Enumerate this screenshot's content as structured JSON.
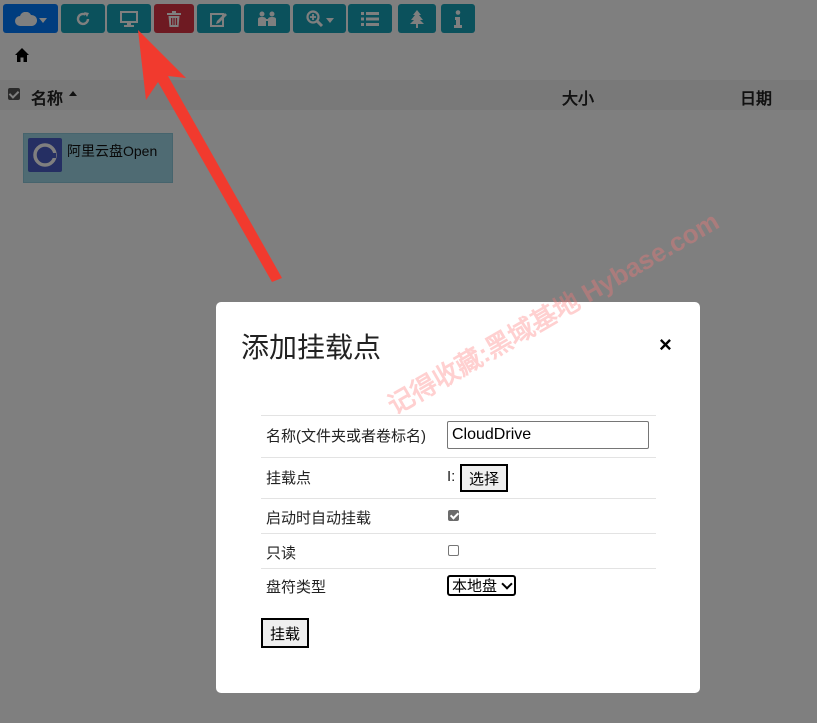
{
  "toolbar": {
    "buttons": [
      {
        "icon": "cloud-icon"
      },
      {
        "icon": "refresh-icon"
      },
      {
        "icon": "monitor-icon"
      },
      {
        "icon": "trash-icon"
      },
      {
        "icon": "edit-icon"
      },
      {
        "icon": "users-icon"
      },
      {
        "icon": "zoom-in-icon"
      },
      {
        "icon": "list-icon"
      },
      {
        "icon": "tree-icon"
      },
      {
        "icon": "info-icon"
      }
    ],
    "colors": {
      "primary": "#007bff",
      "info": "#17a2b8",
      "danger": "#dc3545"
    }
  },
  "file_list": {
    "headers": {
      "name": "名称",
      "size": "大小",
      "date": "日期"
    },
    "items": [
      {
        "label": "阿里云盘Open",
        "selected": true
      }
    ]
  },
  "modal": {
    "title": "添加挂载点",
    "close": "×",
    "fields": {
      "name_label": "名称(文件夹或者卷标名)",
      "name_value": "CloudDrive",
      "mount_point_label": "挂载点",
      "mount_point_value": "I:",
      "select_button": "选择",
      "auto_mount_label": "启动时自动挂载",
      "auto_mount_checked": true,
      "readonly_label": "只读",
      "readonly_checked": false,
      "drive_type_label": "盘符类型",
      "drive_type_value": "本地盘"
    },
    "submit": "挂载"
  },
  "watermark": "记得收藏:黑域基地 Hybase.com"
}
